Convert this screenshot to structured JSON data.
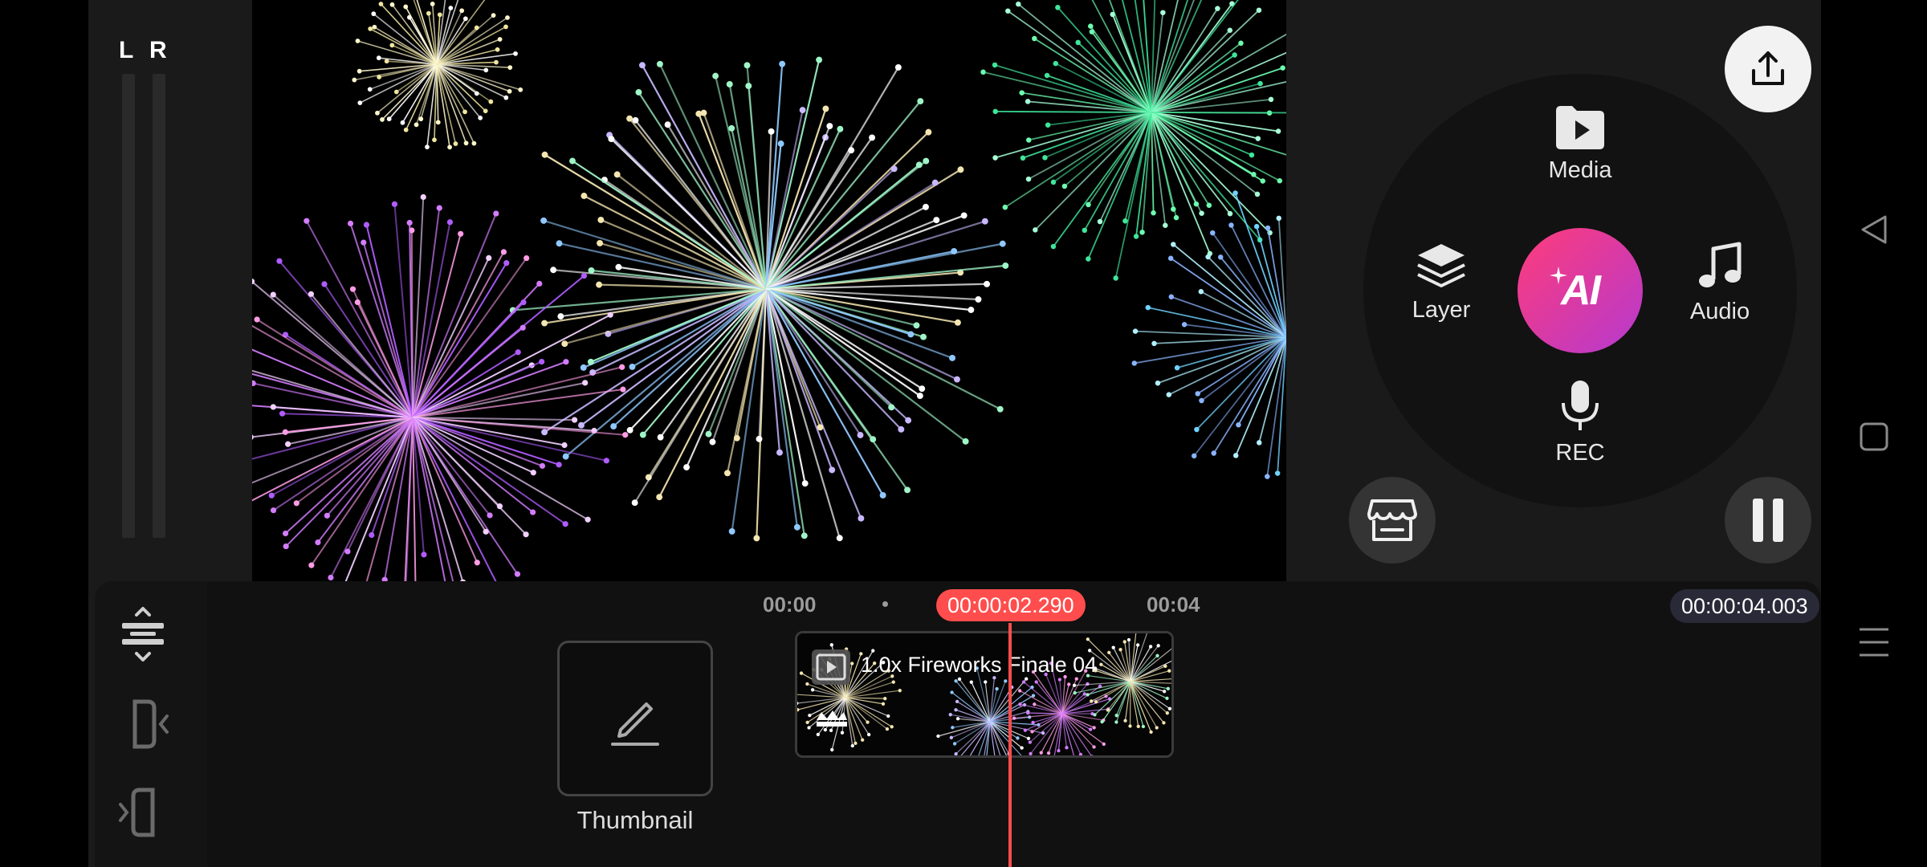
{
  "meters": {
    "left_label": "L",
    "right_label": "R"
  },
  "radial_menu": {
    "media": {
      "label": "Media",
      "icon": "media-folder-icon"
    },
    "layer": {
      "label": "Layer",
      "icon": "layers-icon"
    },
    "audio": {
      "label": "Audio",
      "icon": "music-note-icon"
    },
    "rec": {
      "label": "REC",
      "icon": "microphone-icon"
    },
    "ai": {
      "label": "AI",
      "icon": "sparkle-icon",
      "gradient": [
        "#ff3c7a",
        "#b53ad1"
      ]
    }
  },
  "buttons": {
    "export_icon": "share-upload-icon",
    "store_icon": "store-icon",
    "pause_icon": "pause-icon"
  },
  "timeline": {
    "tick_start": "00:00",
    "tick_end": "00:04",
    "current_time": "00:00:02.290",
    "duration": "00:00:04.003",
    "playhead_color": "#ff4d4d",
    "thumbnail_label": "Thumbnail",
    "clip_title": "1.0x Fireworks Finale 04"
  },
  "colors": {
    "accent_red": "#ff4d4d",
    "ai_gradient_start": "#ff3c7a",
    "ai_gradient_end": "#b53ad1"
  }
}
